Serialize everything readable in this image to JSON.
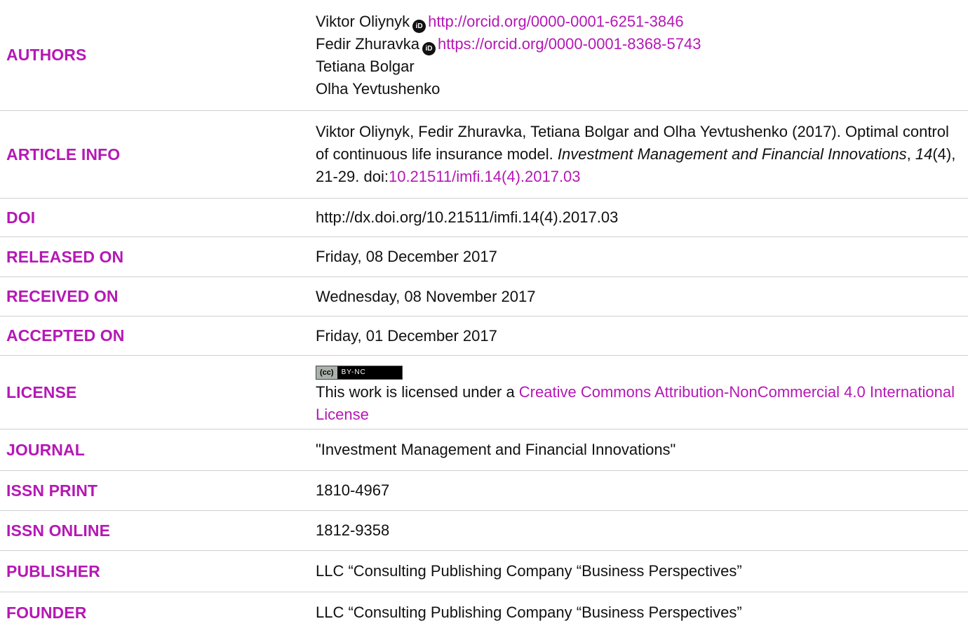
{
  "rows": {
    "authors": {
      "label": "AUTHORS",
      "people": [
        {
          "name": "Viktor Oliynyk",
          "orcid": "http://orcid.org/0000-0001-6251-3846"
        },
        {
          "name": "Fedir Zhuravka",
          "orcid": "https://orcid.org/0000-0001-8368-5743"
        },
        {
          "name": "Tetiana Bolgar"
        },
        {
          "name": "Olha Yevtushenko"
        }
      ],
      "orcid_icon_text": "iD"
    },
    "article_info": {
      "label": "ARTICLE INFO",
      "citation_pre": "Viktor Oliynyk, Fedir Zhuravka, Tetiana Bolgar and Olha Yevtushenko (2017). Optimal control of continuous life insurance model. ",
      "journal_italic": "Investment Management and Financial Innovations",
      "sep": ", ",
      "volume_italic": "14",
      "rest": "(4), 21-29. doi:",
      "doi_link": "10.21511/imfi.14(4).2017.03"
    },
    "doi": {
      "label": "DOI",
      "value": "http://dx.doi.org/10.21511/imfi.14(4).2017.03"
    },
    "released": {
      "label": "RELEASED ON",
      "value": "Friday, 08 December 2017"
    },
    "received": {
      "label": "RECEIVED ON",
      "value": "Wednesday, 08 November 2017"
    },
    "accepted": {
      "label": "ACCEPTED ON",
      "value": "Friday, 01 December 2017"
    },
    "license": {
      "label": "LICENSE",
      "badge_left": "(cc)",
      "badge_right": "BY-NC",
      "text_pre": "This work is licensed under a ",
      "link": "Creative Commons Attribution-NonCommercial 4.0 International License"
    },
    "journal": {
      "label": "JOURNAL",
      "value": "\"Investment Management and Financial Innovations\""
    },
    "issn_print": {
      "label": "ISSN PRINT",
      "value": "1810-4967"
    },
    "issn_online": {
      "label": "ISSN ONLINE",
      "value": "1812-9358"
    },
    "publisher": {
      "label": "PUBLISHER",
      "value": "LLC “Consulting Publishing Company “Business Perspectives”"
    },
    "founder": {
      "label": "FOUNDER",
      "value": "LLC “Consulting Publishing Company “Business Perspectives”"
    }
  },
  "colors": {
    "label": "#b518b5",
    "text": "#111111",
    "divider": "#cfcfcf"
  }
}
